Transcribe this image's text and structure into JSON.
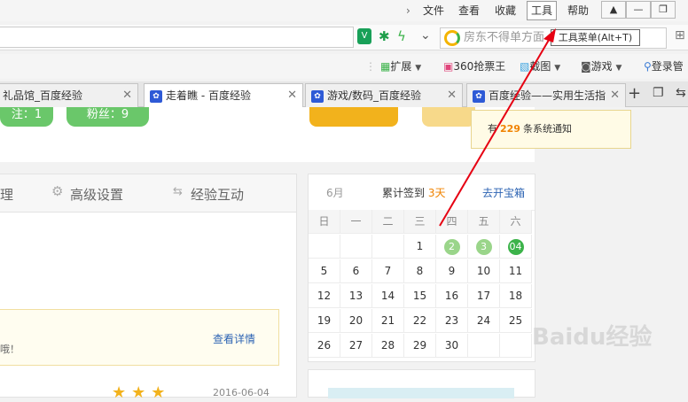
{
  "menubar": {
    "items": [
      "文件",
      "查看",
      "收藏",
      "工具",
      "帮助"
    ],
    "active": "工具"
  },
  "tooltip": "工具菜单(Alt+T)",
  "addressbar": {
    "search_text": "房东不得单方面"
  },
  "toolbar": {
    "items": [
      "扩展",
      "360抢票王",
      "截图",
      "游戏",
      "登录管"
    ]
  },
  "tabs": [
    {
      "label": "礼品馆_百度经验"
    },
    {
      "label": "走着瞧 - 百度经验"
    },
    {
      "label": "游戏/数码_百度经验"
    },
    {
      "label": "百度经验——实用生活指"
    }
  ],
  "profile": {
    "follow_label": "注：1",
    "fans_label": "粉丝：9"
  },
  "left_tabs": [
    "理",
    "高级设置",
    "经验互动"
  ],
  "notice": {
    "text_fragment": "哦！",
    "detail_link": "查看详情",
    "date": "2016-06-04"
  },
  "popup": {
    "prefix": "有",
    "count": "229",
    "suffix": "条系统通知"
  },
  "calendar": {
    "month": "6月",
    "streak_prefix": "累计签到",
    "streak_days": "3天",
    "treasure_link": "去开宝箱",
    "weekdays": [
      "日",
      "一",
      "二",
      "三",
      "四",
      "五",
      "六"
    ],
    "rows": [
      [
        "",
        "",
        "",
        "1",
        "2",
        "3",
        "04"
      ],
      [
        "5",
        "6",
        "7",
        "8",
        "9",
        "10",
        "11"
      ],
      [
        "12",
        "13",
        "14",
        "15",
        "16",
        "17",
        "18"
      ],
      [
        "19",
        "20",
        "21",
        "22",
        "23",
        "24",
        "25"
      ],
      [
        "26",
        "27",
        "28",
        "29",
        "30",
        "",
        ""
      ]
    ],
    "signed_days": [
      "2",
      "3"
    ],
    "today": "04"
  },
  "watermark": "Baidu经验",
  "colors": {
    "accent_green": "#6ac76a",
    "link_blue": "#2d64b3",
    "orange": "#f08300",
    "arrow_red": "#e60012"
  }
}
